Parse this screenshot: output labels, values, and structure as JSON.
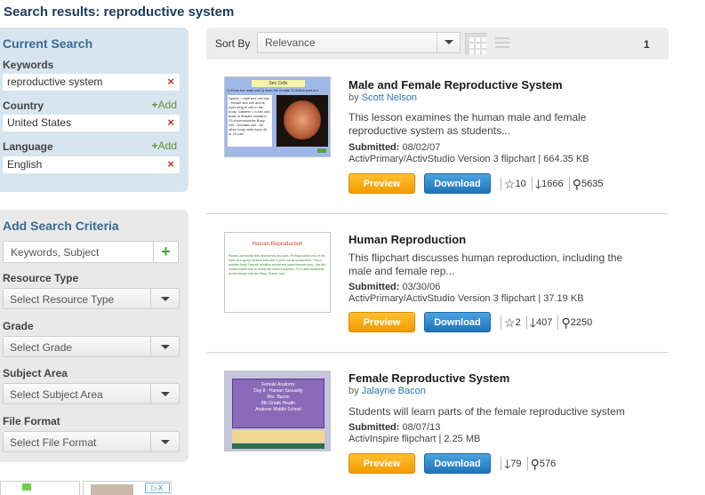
{
  "page": {
    "title": "Search results: reproductive system"
  },
  "current_search": {
    "heading": "Current Search",
    "keywords_label": "Keywords",
    "keywords_value": "reproductive system",
    "country_label": "Country",
    "country_value": "United States",
    "language_label": "Language",
    "language_value": "English",
    "add_label": "Add",
    "remove_glyph": "×"
  },
  "add_criteria": {
    "heading": "Add Search Criteria",
    "keywords_placeholder": "Keywords, Subject",
    "add_glyph": "+",
    "resource_type_label": "Resource Type",
    "resource_type_value": "Select Resource Type",
    "grade_label": "Grade",
    "grade_value": "Select Grade",
    "subject_area_label": "Subject Area",
    "subject_area_value": "Select Subject Area",
    "file_format_label": "File Format",
    "file_format_value": "Select File Format"
  },
  "sort": {
    "label": "Sort By",
    "value": "Relevance",
    "page": "1"
  },
  "results": [
    {
      "title": "Male and Female Reproductive System",
      "by_prefix": "by",
      "author": "Scott Nelson",
      "description": "This lesson examines the human male and female reproductive system as students...",
      "submitted_label": "Submitted:",
      "submitted_date": "08/02/07",
      "format": "ActivPrimary/ActivStudio Version 3 flipchart | 664.35 KB",
      "preview_label": "Preview",
      "download_label": "Download",
      "rating": "10",
      "downloads": "1666",
      "views": "5635",
      "thumb_heading": "Sex Cells",
      "thumb_subheading": "1) From the male cell 2) from the female 3) Which part are",
      "thumb_text": "Sperm - male sex cell boy - female sex cell and is eyes sing in cell in the body. Gamete = a sex cell, male or female contains 23 chromosomes Body cell - Somatic cell - All other body cells have 46 or 23 pair"
    },
    {
      "title": "Human Reproduction",
      "by_prefix": "",
      "author": "",
      "description": "This flipchart discusses human reproduction, including the male and female rep...",
      "submitted_label": "Submitted:",
      "submitted_date": "03/30/06",
      "format": "ActivPrimary/ActivStudio Version 3 flipchart | 37.19 KB",
      "preview_label": "Preview",
      "download_label": "Download",
      "rating": "2",
      "downloads": "407",
      "views": "2250",
      "thumb_heading": "Human Reproduction",
      "thumb_text": "Please use/modify this flipchart as you wish. Perhaps at the end of the topic as a group revision exercise or print out as worksheets. This is another Andy Fawcett modified worksheet (www.fawcett.com). Use the bucket eraser tool to reveal the correct answers. For a less traditional reveal simply click the Show Screen icon."
    },
    {
      "title": "Female Reproductive System",
      "by_prefix": "by",
      "author": "Jalayne Bacon",
      "description": "Students will learn parts of the female reproductive system",
      "submitted_label": "Submitted:",
      "submitted_date": "08/07/13",
      "format": "ActivInspire flipchart | 2.25 MB",
      "preview_label": "Preview",
      "download_label": "Download",
      "downloads": "79",
      "views": "576",
      "thumb_lines": [
        "Female Anatomy",
        "Day 8 - Human Sexuality",
        "Mrs. Bacon",
        "8th Grade Health",
        "Andover Middle School"
      ]
    }
  ],
  "ad": {
    "badge": "▷X"
  },
  "colors": {
    "heading": "#3a6b96",
    "preview": "#f29b00",
    "download": "#1f73b8",
    "remove": "#c8312c",
    "add": "#4aa33a"
  }
}
